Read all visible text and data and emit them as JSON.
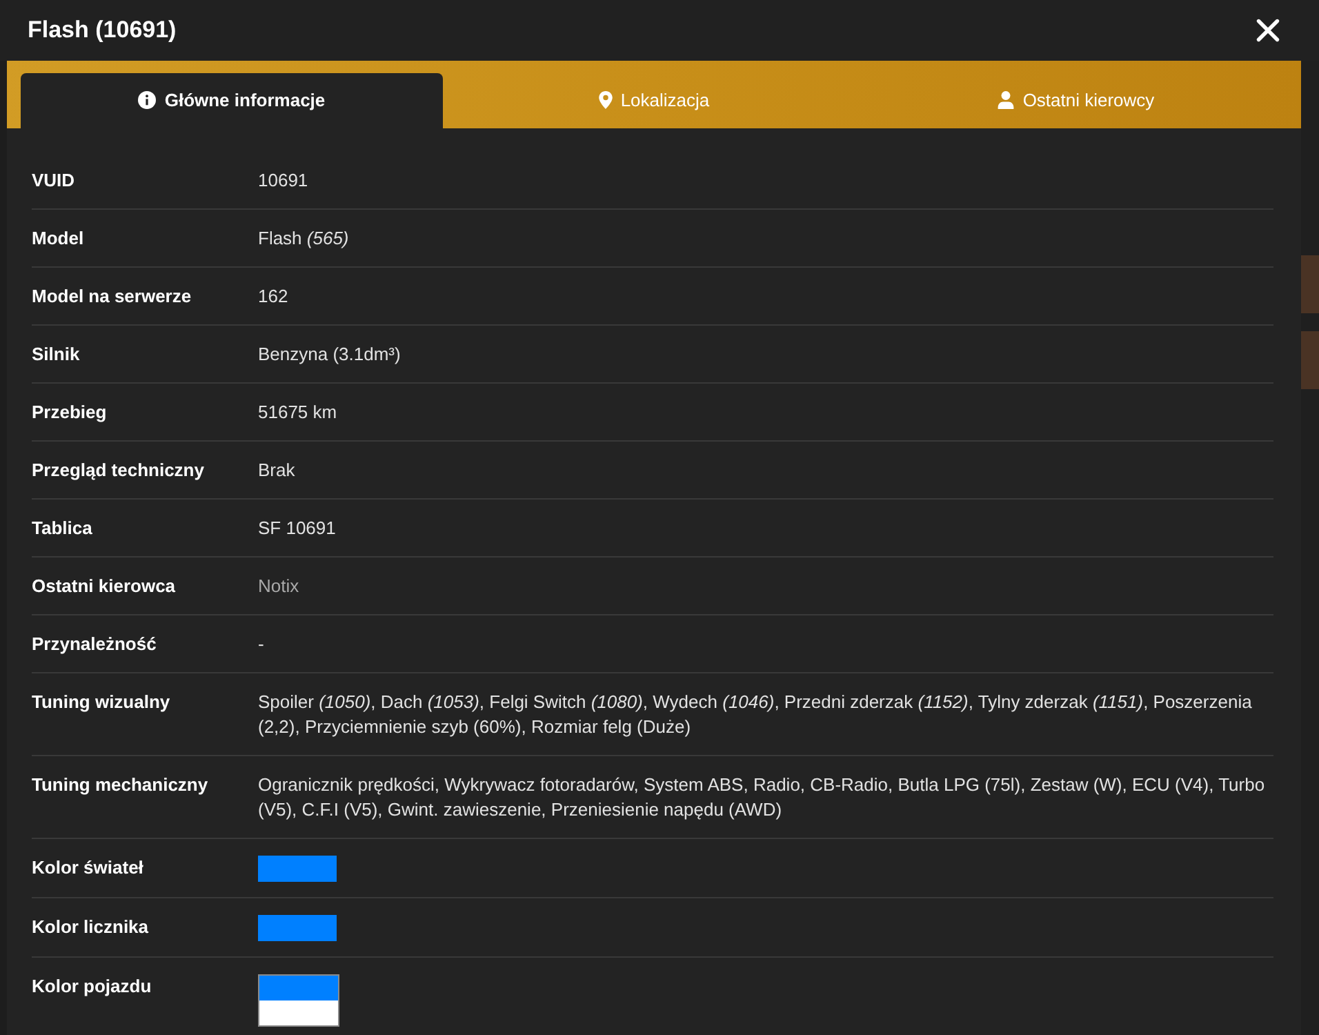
{
  "dialog": {
    "title": "Flash (10691)"
  },
  "tabs": [
    {
      "label": "Główne informacje",
      "selected": true
    },
    {
      "label": "Lokalizacja",
      "selected": false
    },
    {
      "label": "Ostatni kierowcy",
      "selected": false
    }
  ],
  "rows": [
    {
      "label": "VUID",
      "kind": "text",
      "value": "10691"
    },
    {
      "label": "Model",
      "kind": "text",
      "value": "Flash *(565)*"
    },
    {
      "label": "Model na serwerze",
      "kind": "text",
      "value": "162"
    },
    {
      "label": "Silnik",
      "kind": "text",
      "value": "Benzyna (3.1dm³)"
    },
    {
      "label": "Przebieg",
      "kind": "text",
      "value": "51675 km"
    },
    {
      "label": "Przegląd techniczny",
      "kind": "text",
      "value": "Brak"
    },
    {
      "label": "Tablica",
      "kind": "text",
      "value": "SF 10691"
    },
    {
      "label": "Ostatni kierowca",
      "kind": "link",
      "value": "Notix"
    },
    {
      "label": "Przynależność",
      "kind": "text",
      "value": "-"
    },
    {
      "label": "Tuning wizualny",
      "kind": "text",
      "value": "Spoiler *(1050)*, Dach *(1053)*, Felgi Switch *(1080)*, Wydech *(1046)*, Przedni zderzak *(1152)*, Tylny zderzak *(1151)*, Poszerzenia (2,2), Przyciemnienie szyb (60%), Rozmiar felg (Duże)"
    },
    {
      "label": "Tuning mechaniczny",
      "kind": "text",
      "value": "Ogranicznik prędkości, Wykrywacz fotoradarów, System ABS, Radio, CB-Radio, Butla LPG (75l), Zestaw (W), ECU (V4), Turbo (V5), C.F.I (V5), Gwint. zawieszenie, Przeniesienie napędu (AWD)"
    },
    {
      "label": "Kolor świateł",
      "kind": "swatch",
      "swatches": [
        {
          "color": "#0080ff"
        }
      ]
    },
    {
      "label": "Kolor licznika",
      "kind": "swatch",
      "swatches": [
        {
          "color": "#0080ff"
        }
      ]
    },
    {
      "label": "Kolor pojazdu",
      "kind": "swatch",
      "swatches": [
        {
          "color": "#0080ff"
        },
        {
          "color": "#ffffff"
        }
      ]
    }
  ]
}
